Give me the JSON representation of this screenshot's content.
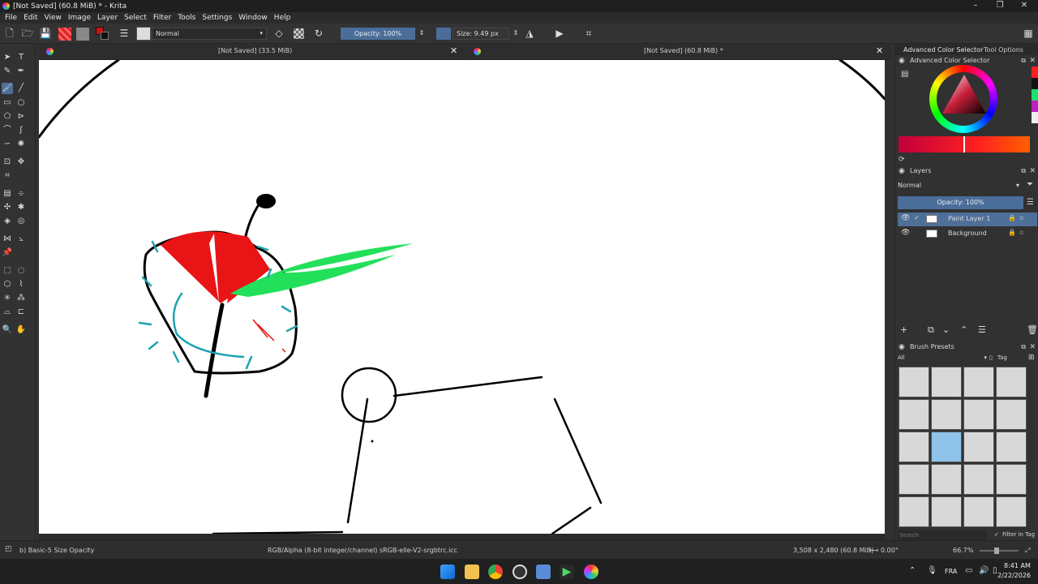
{
  "window": {
    "title": "[Not Saved]  (60.8 MiB) * - Krita",
    "min_icon": "minimize-icon",
    "max_icon": "restore-icon",
    "close_icon": "close-icon"
  },
  "menu": [
    "File",
    "Edit",
    "View",
    "Image",
    "Layer",
    "Select",
    "Filter",
    "Tools",
    "Settings",
    "Window",
    "Help"
  ],
  "toolbar": {
    "blend_mode": "Normal",
    "opacity": "Opacity: 100%",
    "size": "Size: 9.49 px"
  },
  "tabs": {
    "left_label": "[Not Saved]  (33.5 MiB)",
    "right_label": "[Not Saved]  (60.8 MiB) *"
  },
  "dock": {
    "tab_color": "Advanced Color Selector",
    "tab_options": "Tool Options",
    "color_title": "Advanced Color Selector",
    "layers_title": "Layers",
    "layer_blend": "Normal",
    "layer_opacity": "Opacity:  100%",
    "layers": [
      {
        "name": "Paint Layer 1",
        "selected": true
      },
      {
        "name": "Background",
        "selected": false
      }
    ],
    "brush_title": "Brush Presets",
    "brush_filter": "All",
    "tag_label": "Tag",
    "search_placeholder": "Search",
    "filter_in_tag": "Filter in Tag"
  },
  "status": {
    "brush": "b) Basic-5 Size Opacity",
    "color_space": "RGB/Alpha (8-bit integer/channel)  sRGB-elle-V2-srgbtrc.icc",
    "dimensions": "3,508 x 2,480 (60.8 MiB)",
    "rotation": "0.00°",
    "zoom": "66.7%"
  },
  "taskbar": {
    "lang": "FRA",
    "time": "8:41 AM",
    "date": "2/22/2026"
  },
  "colors": {
    "accent": "#4b6d99",
    "selected_layer": "#4e6f98",
    "stroke_red": "#e81416",
    "stroke_green": "#22e05a",
    "stroke_teal": "#1ea3b0"
  }
}
